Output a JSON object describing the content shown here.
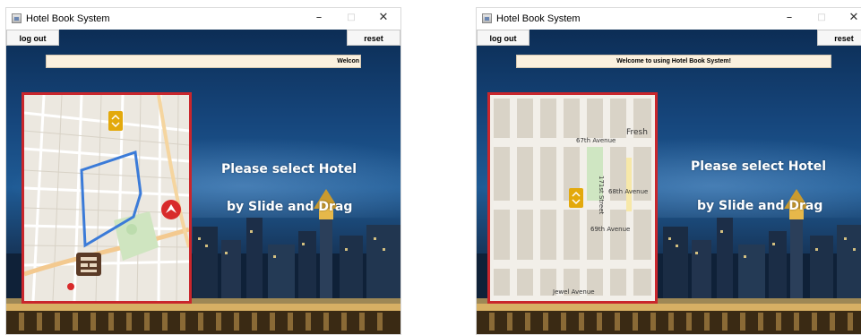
{
  "windows": [
    {
      "title": "Hotel Book System",
      "controls": {
        "minimize": "–",
        "maximize": "□",
        "close": "✕"
      },
      "logout_label": "log out",
      "reset_label": "reset",
      "welcome_text": "Welcon",
      "message_line1": "Please select Hotel",
      "message_line2": "by Slide and Drag",
      "map": {
        "icons": [
          "hotel-marker-icon",
          "arrow-marker-icon",
          "building-marker-icon",
          "pin-icon"
        ]
      }
    },
    {
      "title": "Hotel Book System",
      "controls": {
        "minimize": "–",
        "maximize": "□",
        "close": "✕"
      },
      "logout_label": "log out",
      "reset_label": "reset",
      "welcome_text": "Welcome to using Hotel Book System!",
      "message_line1": "Please select Hotel",
      "message_line2": "by Slide and Drag",
      "map": {
        "street_labels": [
          "67th Avenue",
          "Fresh",
          "68th Avenue",
          "69th Avenue",
          "Jewel Avenue",
          "171st Street"
        ],
        "icons": [
          "hotel-marker-icon"
        ]
      }
    }
  ],
  "colors": {
    "frame_border": "#c9262c",
    "welcome_bg": "#fbf1df",
    "route_line": "#3b7bd8",
    "marker": "#e3a90c"
  }
}
